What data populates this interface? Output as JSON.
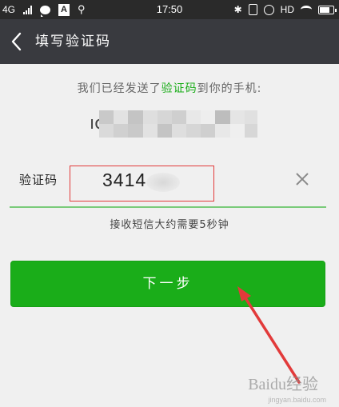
{
  "status_bar": {
    "network": "4G",
    "time": "17:50",
    "hd_label": "HD",
    "icons": [
      "signal-icon",
      "chat-bubble-icon",
      "a-notification-icon",
      "usb-icon",
      "bluetooth-icon",
      "vibrate-icon",
      "alarm-icon",
      "wifi-icon",
      "battery-icon"
    ]
  },
  "header": {
    "back_icon": "back-chevron-icon",
    "title": "填写验证码",
    "background": "#393a3f"
  },
  "content": {
    "prompt_pre": "我们已经发送了",
    "prompt_highlight": "验证码",
    "prompt_post": "到你的手机:",
    "phone_visible": "ıc",
    "code_label": "验证码",
    "code_value": "3414",
    "clear_icon": "close-icon",
    "hint": "接收短信大约需要5秒钟",
    "next_button": "下一步",
    "accent_color": "#1aad19",
    "annotation_color": "#e23a3a"
  },
  "watermark": {
    "text": "Baidu经验",
    "sub": "jingyan.baidu.com"
  }
}
